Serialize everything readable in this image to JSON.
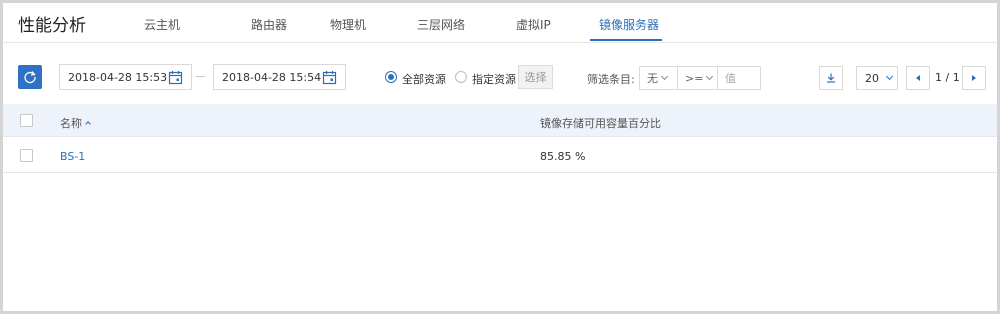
{
  "header": {
    "title": "性能分析",
    "tabs": [
      {
        "label": "云主机"
      },
      {
        "label": "路由器"
      },
      {
        "label": "物理机"
      },
      {
        "label": "三层网络"
      },
      {
        "label": "虚拟IP"
      },
      {
        "label": "镜像服务器",
        "active": true
      }
    ]
  },
  "toolbar": {
    "start_time": "2018-04-28 15:53",
    "end_time": "2018-04-28 15:54",
    "scope_all_label": "全部资源",
    "scope_specific_label": "指定资源",
    "scope_selected": "全部资源",
    "choose_label": "选择",
    "filter_label": "筛选条目:",
    "filter_field": "无",
    "filter_operator": ">=",
    "filter_value_placeholder": "值",
    "page_size": "20",
    "page_info": "1 / 1"
  },
  "table": {
    "columns": [
      "名称",
      "镜像存储可用容量百分比"
    ],
    "rows": [
      {
        "name": "BS-1",
        "value": "85.85 %"
      }
    ]
  },
  "colors": {
    "accent": "#2c6fb8",
    "header_bg": "#eef3fb"
  }
}
